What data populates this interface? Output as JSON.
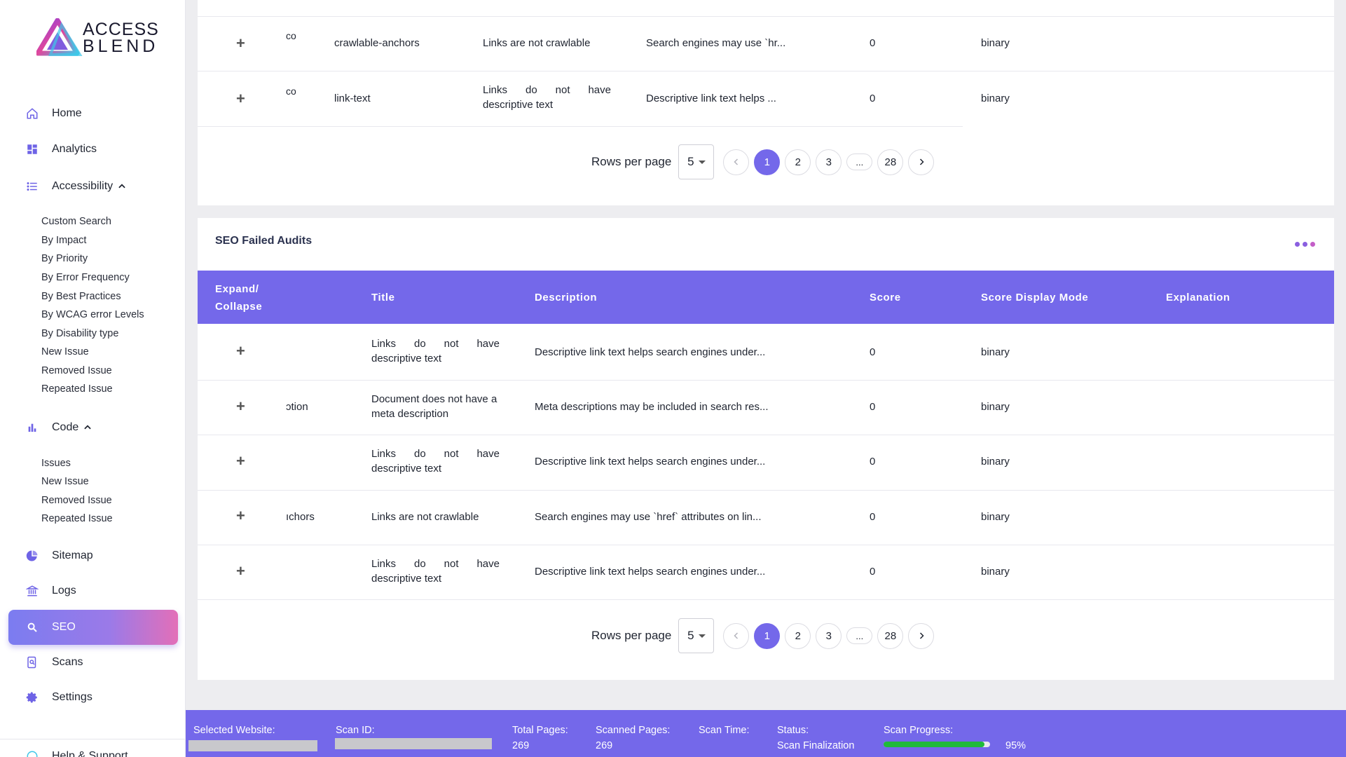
{
  "brand": {
    "line1": "ACCESS",
    "line2": "BLEND"
  },
  "nav": {
    "home": "Home",
    "analytics": "Analytics",
    "accessibility": "Accessibility",
    "accessibility_sub": [
      "Custom Search",
      "By Impact",
      "By Priority",
      "By Error Frequency",
      "By Best Practices",
      "By WCAG error Levels",
      "By Disability type",
      "New Issue",
      "Removed Issue",
      "Repeated Issue"
    ],
    "code": "Code",
    "code_sub": [
      "Issues",
      "New Issue",
      "Removed Issue",
      "Repeated Issue"
    ],
    "sitemap": "Sitemap",
    "logs": "Logs",
    "seo": "SEO",
    "scans": "Scans",
    "settings": "Settings",
    "help": "Help & Support"
  },
  "top_table": {
    "rows": [
      {
        "id": "co",
        "audit": "crawlable-anchors",
        "title": "Links are not crawlable",
        "description": "Search engines may use `hr...",
        "score": "0",
        "mode": "binary"
      },
      {
        "id": "co",
        "audit": "link-text",
        "title": "Links do not have descriptive text",
        "description": "Descriptive link text helps ...",
        "score": "0",
        "mode": "binary"
      }
    ],
    "pager": {
      "rows_per_page_label": "Rows per page",
      "rows_per_page": "5",
      "pages": [
        "1",
        "2",
        "3",
        "...",
        "28"
      ],
      "current": "1"
    }
  },
  "seo_card": {
    "title": "SEO Failed Audits",
    "columns": [
      "Expand/ Collapse",
      "Title",
      "Description",
      "Score",
      "Score Display Mode",
      "Explanation"
    ],
    "rows": [
      {
        "id": "",
        "title": "Links do not have descriptive text",
        "description": "Descriptive link text helps search engines under...",
        "score": "0",
        "mode": "binary"
      },
      {
        "id": "ɔtion",
        "title": "Document does not have a meta description",
        "description": "Meta descriptions may be included in search res...",
        "score": "0",
        "mode": "binary"
      },
      {
        "id": "",
        "title": "Links do not have descriptive text",
        "description": "Descriptive link text helps search engines under...",
        "score": "0",
        "mode": "binary"
      },
      {
        "id": "ıchors",
        "title": "Links are not crawlable",
        "description": "Search engines may use `href` attributes on lin...",
        "score": "0",
        "mode": "binary"
      },
      {
        "id": "",
        "title": "Links do not have descriptive text",
        "description": "Descriptive link text helps search engines under...",
        "score": "0",
        "mode": "binary"
      }
    ],
    "expand_symbol": "+",
    "pager": {
      "rows_per_page_label": "Rows per page",
      "rows_per_page": "5",
      "pages": [
        "1",
        "2",
        "3",
        "...",
        "28"
      ],
      "current": "1"
    }
  },
  "status": {
    "selected_website_label": "Selected Website:",
    "scan_id_label": "Scan ID:",
    "total_pages_label": "Total Pages:",
    "total_pages": "269",
    "scanned_pages_label": "Scanned Pages:",
    "scanned_pages": "269",
    "scan_time_label": "Scan Time:",
    "status_label": "Status:",
    "status_value": "Scan Finalization",
    "scan_progress_label": "Scan Progress:",
    "scan_progress": "95%",
    "scan_progress_fraction": 0.95
  },
  "colors": {
    "accent": "#7468ea",
    "progress": "#1fba3a",
    "active_nav_start": "#7b7cf0",
    "active_nav_end": "#e36fb8"
  },
  "icons": {
    "home": "home-icon",
    "analytics": "dashboard-icon",
    "accessibility": "list-icon",
    "code": "bar-chart-icon",
    "sitemap": "pie-chart-icon",
    "logs": "bank-icon",
    "seo": "search-icon",
    "scans": "scan-search-icon",
    "settings": "gear-icon",
    "help": "help-icon"
  }
}
